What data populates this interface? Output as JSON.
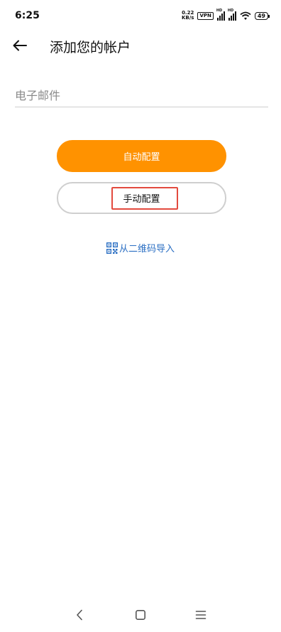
{
  "status_bar": {
    "time": "6:25",
    "net_speed_value": "0.22",
    "net_speed_unit": "KB/s",
    "vpn": "VPN",
    "signal_1_label": "HD",
    "signal_2_label": "HD",
    "battery": "49"
  },
  "header": {
    "back_icon": "arrow-left-icon",
    "title": "添加您的帐户"
  },
  "form": {
    "email_placeholder": "电子邮件",
    "email_value": ""
  },
  "buttons": {
    "auto_config": "自动配置",
    "manual_config": "手动配置"
  },
  "qr_import": {
    "icon": "qr-code-icon",
    "label": "从二维码导入"
  },
  "colors": {
    "accent": "#ff9200",
    "link": "#2b6fc3",
    "highlight": "#e34a3e"
  },
  "nav_bar": {
    "icons": [
      "back-chevron-icon",
      "home-square-icon",
      "menu-lines-icon"
    ]
  }
}
